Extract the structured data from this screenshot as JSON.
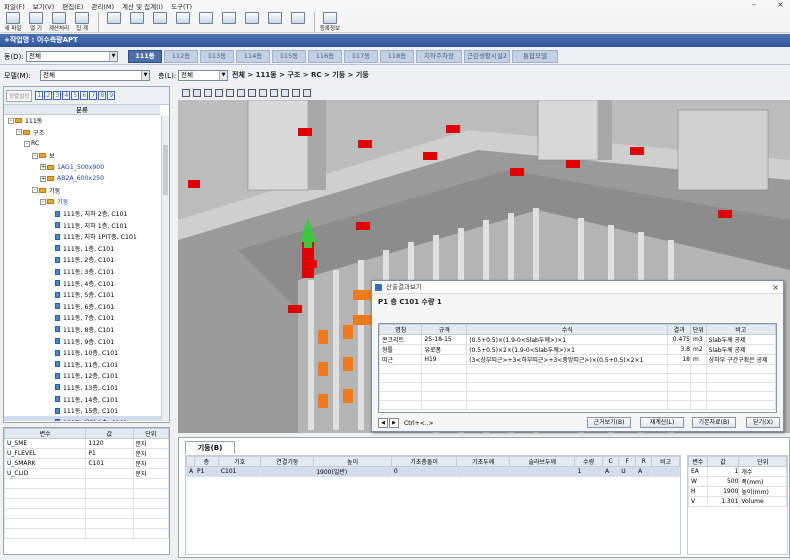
{
  "menu": [
    "파일(F)",
    "보기(V)",
    "편집(E)",
    "관리(M)",
    "계산 및 집계(I)",
    "도구(T)"
  ],
  "toolbar": {
    "buttons": [
      {
        "label": "새 파일",
        "icon": "new-file-icon"
      },
      {
        "label": "열 기",
        "icon": "open-icon"
      },
      {
        "label": "계산처리",
        "icon": "calc-icon"
      },
      {
        "label": "집 계",
        "icon": "aggregate-icon"
      },
      {
        "label": "",
        "icon": "tool-icon"
      },
      {
        "label": "",
        "icon": "tool-icon"
      },
      {
        "label": "",
        "icon": "tool-icon"
      },
      {
        "label": "",
        "icon": "tool-icon"
      },
      {
        "label": "",
        "icon": "tool-icon"
      },
      {
        "label": "",
        "icon": "tool-icon"
      },
      {
        "label": "",
        "icon": "tool-icon"
      },
      {
        "label": "",
        "icon": "tool-icon"
      },
      {
        "label": "",
        "icon": "tool-icon"
      },
      {
        "label": "등록정보",
        "icon": "properties-icon"
      }
    ]
  },
  "project": {
    "title": "+작업명 : 이수측량APT"
  },
  "building": {
    "label": "동(D):",
    "value": "전체"
  },
  "tabs": [
    "111동",
    "112동",
    "113동",
    "114동",
    "115동",
    "116동",
    "117동",
    "118동",
    "지하주차장",
    "근린생활시설2",
    "통합모델"
  ],
  "active_tab": 0,
  "model": {
    "label": "모델(M):",
    "value": "전체"
  },
  "floor": {
    "label": "층(L):",
    "value": "전체"
  },
  "breadcrumb": "전체 > 111동 > 구조 > RC > 기둥 > 기둥",
  "left": {
    "sort_label": "정렬설정",
    "numbers": [
      "1",
      "2",
      "3",
      "4",
      "5",
      "6",
      "7",
      "8",
      "9"
    ],
    "header": "분류",
    "tree": [
      {
        "level": 0,
        "label": "111동",
        "type": "folder",
        "toggle": "-"
      },
      {
        "level": 1,
        "label": "구조",
        "type": "folder",
        "toggle": "-"
      },
      {
        "level": 2,
        "label": "RC",
        "type": "none",
        "toggle": "-"
      },
      {
        "level": 3,
        "label": "보",
        "type": "folder",
        "toggle": "-"
      },
      {
        "level": 4,
        "label": "1AG1_500x900",
        "type": "folder",
        "toggle": "+",
        "blue": true
      },
      {
        "level": 4,
        "label": "AB2A_600x250",
        "type": "folder",
        "toggle": "+",
        "blue": true
      },
      {
        "level": 3,
        "label": "기둥",
        "type": "folder",
        "toggle": "-"
      },
      {
        "level": 4,
        "label": "기둥",
        "type": "folder",
        "toggle": "-",
        "blue": true
      },
      {
        "level": 5,
        "label": "111동, 지하 2층, C101",
        "type": "doc"
      },
      {
        "level": 5,
        "label": "111동, 지하 1층, C101",
        "type": "doc"
      },
      {
        "level": 5,
        "label": "111동, 지하 1PIT층, C101",
        "type": "doc"
      },
      {
        "level": 5,
        "label": "111동, 1층, C101",
        "type": "doc"
      },
      {
        "level": 5,
        "label": "111동, 2층, C101",
        "type": "doc"
      },
      {
        "level": 5,
        "label": "111동, 3층, C101",
        "type": "doc"
      },
      {
        "level": 5,
        "label": "111동, 4층, C101",
        "type": "doc"
      },
      {
        "level": 5,
        "label": "111동, 5층, C101",
        "type": "doc"
      },
      {
        "level": 5,
        "label": "111동, 6층, C101",
        "type": "doc"
      },
      {
        "level": 5,
        "label": "111동, 7층, C101",
        "type": "doc"
      },
      {
        "level": 5,
        "label": "111동, 8층, C101",
        "type": "doc"
      },
      {
        "level": 5,
        "label": "111동, 9층, C101",
        "type": "doc"
      },
      {
        "level": 5,
        "label": "111동, 10층, C101",
        "type": "doc"
      },
      {
        "level": 5,
        "label": "111동, 11층, C101",
        "type": "doc"
      },
      {
        "level": 5,
        "label": "111동, 12층, C101",
        "type": "doc"
      },
      {
        "level": 5,
        "label": "111동, 13층, C101",
        "type": "doc"
      },
      {
        "level": 5,
        "label": "111동, 14층, C101",
        "type": "doc"
      },
      {
        "level": 5,
        "label": "111동, 15층, C101",
        "type": "doc"
      },
      {
        "level": 5,
        "label": "111동, 옥탑 1층, C101",
        "type": "doc",
        "selected": true
      },
      {
        "level": 4,
        "label": "AB2A_600x600",
        "type": "folder",
        "toggle": "+",
        "blue": true
      }
    ]
  },
  "props": {
    "headers": [
      "변수",
      "값",
      "단위"
    ],
    "rows": [
      [
        "U_SME",
        "1120",
        "문자"
      ],
      [
        "U_FLEVEL",
        "P1",
        "문자"
      ],
      [
        "U_SMARK",
        "C101",
        "문자"
      ],
      [
        "U_CLID",
        "",
        "문자"
      ]
    ]
  },
  "dialog": {
    "title": "산출결과보기",
    "close": "×",
    "heading": "P1 층 C101  수량 1",
    "headers": [
      "명칭",
      "규격",
      "수식",
      "결과",
      "단위",
      "비고"
    ],
    "rows": [
      [
        "콘크리트",
        "25-18-15",
        "(0.5+0.5)×(1.9-0<Slab두께>)×1",
        "0.475",
        "m3",
        "Slab두께 공제"
      ],
      [
        "형틀",
        "유로폼",
        "(0.5+0.5)×2×(1.9-0<Slab두께>)×1",
        "3.8",
        "m2",
        "Slab두께 공제"
      ],
      [
        "띠근",
        "H19",
        "(3<상부띠근>+3<하부띠근>+3<중앙띠근>)×(0.5+0.5)×2×1",
        "18",
        "m",
        "상하부 구간구획은 공제"
      ]
    ],
    "shortcut": "Ctrl+<..>",
    "buttons": [
      "근거보기(B)",
      "재계산(L)",
      "기본자료(B)",
      "닫기(X)"
    ]
  },
  "bottom": {
    "tab": "기둥(B)",
    "headers": [
      "층",
      "기호",
      "연결기둥",
      "높이",
      "기초충돌이",
      "기초두께",
      "슬라브두께",
      "수량",
      "C",
      "F",
      "R",
      "비고"
    ],
    "row": [
      "P1",
      "C101",
      "",
      "1900(일반)",
      "0",
      "",
      "",
      "1",
      "A",
      "U",
      "A",
      ""
    ],
    "row_marker": "A",
    "right_headers": [
      "변수",
      "값",
      "단위"
    ],
    "right_rows": [
      [
        "EA",
        "1",
        "개수"
      ],
      [
        "W",
        "500",
        "폭(mm)"
      ],
      [
        "H",
        "1900",
        "높이(mm)"
      ],
      [
        "V",
        "1.301",
        "Volume"
      ]
    ]
  },
  "colors": {
    "accent": "#4c6fa8",
    "roof": "#8a8a8a",
    "wall": "#dcdcdc",
    "red": "#e00000",
    "orange": "#f07a1a",
    "green": "#3cc83c"
  }
}
